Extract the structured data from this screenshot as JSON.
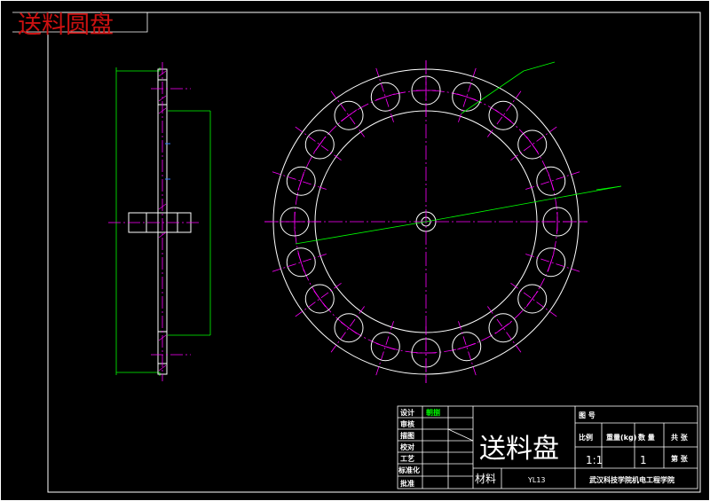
{
  "sheet": {
    "corner_title": "送料圆盘",
    "colors": {
      "background": "#000000",
      "outline": "#ffffff",
      "centerline": "#ff00ff",
      "dimension": "#00ff00",
      "title": "#cc1111"
    }
  },
  "title_block": {
    "part_name": "送料盘",
    "rows": [
      {
        "label": "设计",
        "value": "朝捌"
      },
      {
        "label": "审核",
        "value": ""
      },
      {
        "label": "描图",
        "value": ""
      },
      {
        "label": "校对",
        "value": ""
      },
      {
        "label": "工艺",
        "value": ""
      },
      {
        "label": "标准化",
        "value": ""
      },
      {
        "label": "批准",
        "value": ""
      }
    ],
    "drawing_no_label": "图 号",
    "scale_label": "比例",
    "weight_label": "重量(kg)",
    "qty_label": "数 量",
    "total_sheets_label": "共 张",
    "sheet_no_label": "第 张",
    "scale_value": "1:1",
    "qty_value": "1",
    "material_label": "材料",
    "material_value": "YL13",
    "school": "武汉科技学院机电工程学院"
  }
}
